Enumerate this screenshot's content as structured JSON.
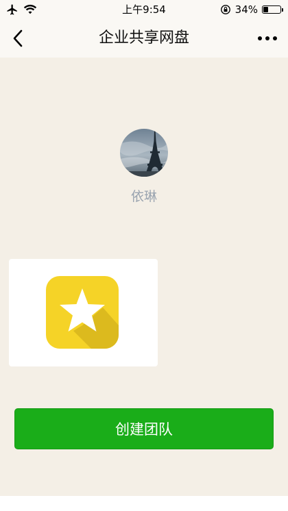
{
  "status_bar": {
    "time": "上午9:54",
    "battery_text": "34%",
    "battery_level": 0.34
  },
  "nav": {
    "title": "企业共享网盘",
    "back_icon": "chevron-left-icon",
    "more_icon": "more-dots-icon"
  },
  "profile": {
    "name": "依琳",
    "avatar_icon": "eiffel-tower-avatar"
  },
  "card": {
    "icon": "star-icon",
    "icon_color": "#f5d327"
  },
  "actions": {
    "create_team_label": "创建团队",
    "button_color": "#1aad19"
  }
}
